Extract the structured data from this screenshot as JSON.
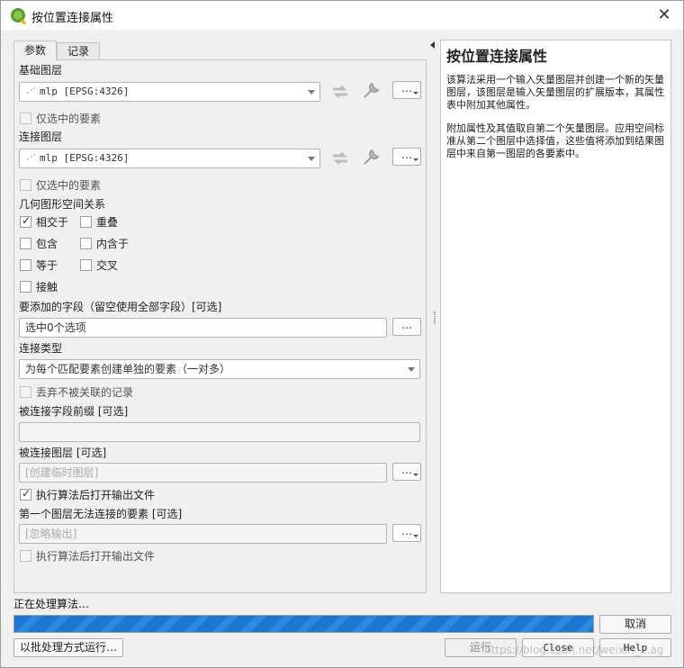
{
  "window": {
    "title": "按位置连接属性",
    "close_glyph": "✕"
  },
  "tabs": [
    {
      "label": "参数"
    },
    {
      "label": "记录"
    }
  ],
  "form": {
    "base_layer_label": "基础图层",
    "base_layer_value": "mlp [EPSG:4326]",
    "base_selected_only": "仅选中的要素",
    "join_layer_label": "连接图层",
    "join_layer_value": "mlp [EPSG:4326]",
    "join_selected_only": "仅选中的要素",
    "predicate_label": "几何图形空间关系",
    "predicates": [
      {
        "label": "相交于",
        "checked": true
      },
      {
        "label": "重叠",
        "checked": false
      },
      {
        "label": "包含",
        "checked": false
      },
      {
        "label": "内含于",
        "checked": false
      },
      {
        "label": "等于",
        "checked": false
      },
      {
        "label": "交叉",
        "checked": false
      },
      {
        "label": "接触",
        "checked": false
      }
    ],
    "fields_label": "要添加的字段（留空使用全部字段）[可选]",
    "fields_value": "选中0个选项",
    "join_type_label": "连接类型",
    "join_type_value": "为每个匹配要素创建单独的要素（一对多）",
    "discard_label": "丢弃不被关联的记录",
    "prefix_label": "被连接字段前缀 [可选]",
    "prefix_value": "",
    "joined_layer_label": "被连接图层 [可选]",
    "joined_layer_value": "[创建临时图层]",
    "open_output_1": "执行算法后打开输出文件",
    "unjoinable_label": "第一个图层无法连接的要素 [可选]",
    "unjoinable_value": "[忽略输出]",
    "open_output_2": "执行算法后打开输出文件",
    "dots": "…"
  },
  "help": {
    "title": "按位置连接属性",
    "para1": "该算法采用一个输入矢量图层并创建一个新的矢量图层，该图层是输入矢量图层的扩展版本，其属性表中附加其他属性。",
    "para2": "附加属性及其值取自第二个矢量图层。应用空间标准从第二个图层中选择值，这些值将添加到结果图层中来自第一图层的各要素中。"
  },
  "status_text": "正在处理算法…",
  "progress_percent": 100,
  "buttons": {
    "cancel": "取消",
    "batch": "以批处理方式运行…",
    "run": "运行",
    "close": "Close",
    "help": "Help"
  },
  "watermark": "https://blog.csdn.net/weixin_...ag",
  "colors": {
    "progress": "#1a78d4",
    "window_bg": "#f0f0f0"
  }
}
